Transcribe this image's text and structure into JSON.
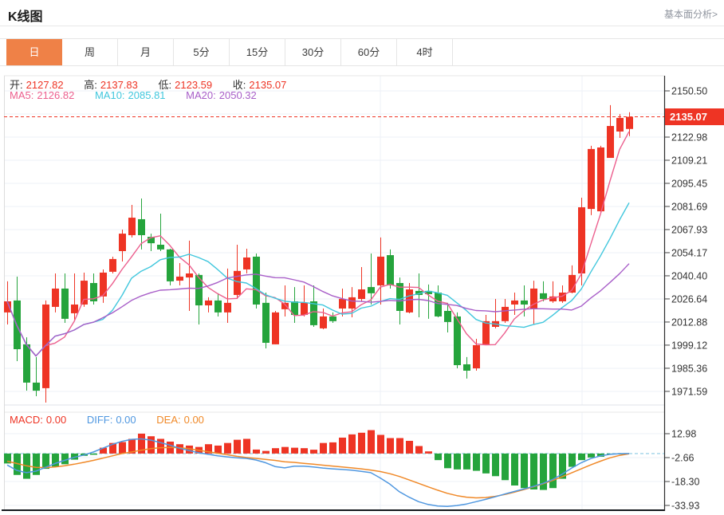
{
  "header": {
    "title": "K线图",
    "link_label": "基本面分析>"
  },
  "tabs": {
    "items": [
      "日",
      "周",
      "月",
      "5分",
      "15分",
      "30分",
      "60分",
      "4时"
    ],
    "active_index": 0
  },
  "info_bar": {
    "open_label": "开:",
    "open_value": "2127.82",
    "high_label": "高:",
    "high_value": "2137.83",
    "low_label": "低:",
    "low_value": "2123.59",
    "close_label": "收:",
    "close_value": "2135.07"
  },
  "ma_bar": {
    "ma5_label": "MA5:",
    "ma5_value": "2126.82",
    "ma10_label": "MA10:",
    "ma10_value": "2085.81",
    "ma20_label": "MA20:",
    "ma20_value": "2050.32"
  },
  "macd_bar": {
    "macd_label": "MACD:",
    "macd_value": "0.00",
    "diff_label": "DIFF:",
    "diff_value": "0.00",
    "dea_label": "DEA:",
    "dea_value": "0.00"
  },
  "colors": {
    "up": "#ee3424",
    "down": "#25a43c",
    "tag": "#ee3424",
    "dashed_price": "#ee3424",
    "ma5": "#ec5f8e",
    "ma10": "#41c7dd",
    "ma20": "#a85ec8",
    "diff_line": "#4f97e0",
    "dea_line": "#f08928",
    "zero_dash": "#9fd4e8",
    "grid": "#edf1f7",
    "axis_text": "#333333",
    "axis_line": "#2b2b2b",
    "value_red": "#ee3424",
    "label_dark": "#333333",
    "active_tab": "#ef8147"
  },
  "chart_data": {
    "type": "candlestick",
    "title": "K线图",
    "legend": [
      "MA5",
      "MA10",
      "MA20",
      "MACD",
      "DIFF",
      "DEA"
    ],
    "price_axis_ticks": [
      "2150.50",
      "2122.98",
      "2109.21",
      "2095.45",
      "2081.69",
      "2067.93",
      "2054.17",
      "2040.40",
      "2026.64",
      "2012.88",
      "1999.12",
      "1985.36",
      "1971.59"
    ],
    "last_price": 2135.07,
    "last_price_label": "2135.07",
    "ylim": [
      1964.7,
      2150.5
    ],
    "ma_periods": [
      5,
      10,
      20
    ],
    "candles": [
      [
        2018.6,
        2037.1,
        2011.4,
        2025.2
      ],
      [
        2025.7,
        2039.9,
        1989.6,
        1996.7
      ],
      [
        1999.6,
        2003.8,
        1972.0,
        1976.8
      ],
      [
        1976.8,
        1992.0,
        1968.7,
        1972.0
      ],
      [
        1973.5,
        2025.7,
        1964.9,
        2023.3
      ],
      [
        2021.9,
        2041.8,
        2018.6,
        2032.8
      ],
      [
        2032.8,
        2041.8,
        2012.4,
        2014.8
      ],
      [
        2018.1,
        2041.8,
        2013.4,
        2023.3
      ],
      [
        2023.3,
        2042.3,
        2021.9,
        2037.5
      ],
      [
        2036.1,
        2041.8,
        2023.3,
        2025.2
      ],
      [
        2028.1,
        2044.2,
        2024.3,
        2042.3
      ],
      [
        2042.8,
        2051.8,
        2041.8,
        2050.4
      ],
      [
        2055.1,
        2067.9,
        2048.9,
        2065.5
      ],
      [
        2064.6,
        2082.6,
        2063.2,
        2075.0
      ],
      [
        2074.1,
        2086.4,
        2056.1,
        2064.6
      ],
      [
        2063.6,
        2065.5,
        2055.1,
        2059.8
      ],
      [
        2058.9,
        2077.4,
        2055.1,
        2056.1
      ],
      [
        2056.1,
        2056.5,
        2034.7,
        2037.1
      ],
      [
        2037.5,
        2048.0,
        2034.7,
        2039.9
      ],
      [
        2039.4,
        2061.3,
        2019.5,
        2041.8
      ],
      [
        2040.9,
        2041.8,
        2011.4,
        2022.8
      ],
      [
        2022.8,
        2027.6,
        2018.6,
        2025.7
      ],
      [
        2025.7,
        2030.0,
        2016.2,
        2018.6
      ],
      [
        2018.6,
        2044.7,
        2012.4,
        2024.3
      ],
      [
        2029.0,
        2058.9,
        2026.6,
        2043.3
      ],
      [
        2044.2,
        2056.5,
        2041.8,
        2051.3
      ],
      [
        2051.8,
        2053.7,
        2020.9,
        2023.3
      ],
      [
        2024.3,
        2030.4,
        1997.2,
        2000.5
      ],
      [
        1999.6,
        2019.5,
        1999.6,
        2018.6
      ],
      [
        2020.5,
        2034.7,
        2016.2,
        2024.3
      ],
      [
        2025.2,
        2033.7,
        2012.4,
        2017.1
      ],
      [
        2017.1,
        2034.7,
        2016.2,
        2024.3
      ],
      [
        2025.2,
        2034.7,
        2010.0,
        2011.0
      ],
      [
        2009.1,
        2020.9,
        2008.6,
        2016.2
      ],
      [
        2016.2,
        2018.6,
        2012.4,
        2013.4
      ],
      [
        2020.9,
        2032.8,
        2016.2,
        2026.6
      ],
      [
        2020.9,
        2033.7,
        2015.7,
        2027.6
      ],
      [
        2026.6,
        2045.6,
        2025.2,
        2032.3
      ],
      [
        2033.7,
        2053.7,
        2023.3,
        2030.0
      ],
      [
        2034.7,
        2063.2,
        2023.3,
        2051.8
      ],
      [
        2052.7,
        2056.1,
        2032.8,
        2034.7
      ],
      [
        2036.1,
        2039.4,
        2011.4,
        2019.5
      ],
      [
        2018.6,
        2036.1,
        2018.1,
        2032.3
      ],
      [
        2031.4,
        2041.8,
        2015.7,
        2029.0
      ],
      [
        2031.4,
        2035.2,
        2014.8,
        2029.5
      ],
      [
        2030.4,
        2034.7,
        2015.7,
        2016.2
      ],
      [
        2019.5,
        2024.3,
        2006.7,
        2012.9
      ],
      [
        2016.2,
        2018.6,
        1985.3,
        1987.2
      ],
      [
        1987.7,
        1992.0,
        1979.2,
        1983.9
      ],
      [
        1985.3,
        2002.9,
        1983.9,
        1999.1
      ],
      [
        1999.6,
        2017.1,
        1999.1,
        2013.4
      ],
      [
        2010.0,
        2026.6,
        2009.1,
        2013.4
      ],
      [
        2013.4,
        2026.6,
        2012.4,
        2021.9
      ],
      [
        2023.3,
        2030.4,
        2017.1,
        2025.7
      ],
      [
        2025.7,
        2034.7,
        2016.2,
        2023.3
      ],
      [
        2020.5,
        2037.5,
        2011.4,
        2032.8
      ],
      [
        2030.0,
        2037.1,
        2025.2,
        2026.6
      ],
      [
        2025.2,
        2037.1,
        2024.3,
        2028.1
      ],
      [
        2025.2,
        2034.7,
        2024.3,
        2030.4
      ],
      [
        2030.4,
        2046.6,
        2030.0,
        2040.9
      ],
      [
        2041.8,
        2086.9,
        2034.7,
        2081.2
      ],
      [
        2080.2,
        2117.8,
        2076.5,
        2115.9
      ],
      [
        2078.8,
        2117.8,
        2077.9,
        2116.8
      ],
      [
        2110.6,
        2142.0,
        2110.6,
        2129.6
      ],
      [
        2126.3,
        2136.7,
        2122.5,
        2134.4
      ],
      [
        2127.82,
        2137.83,
        2123.59,
        2135.07
      ]
    ],
    "macd": {
      "axis_ticks": [
        "12.98",
        "-2.66",
        "-18.30",
        "-33.93"
      ],
      "hist": [
        -6.5,
        -14,
        -16.5,
        -14,
        -10,
        -8.5,
        -7,
        -4,
        -1.5,
        -0.8,
        3.8,
        6.9,
        7.5,
        9.6,
        13,
        11.3,
        9.6,
        7.8,
        6.1,
        5.2,
        4.3,
        6.1,
        5.2,
        6.9,
        9,
        9.6,
        2.6,
        1.7,
        3.5,
        4.3,
        3.8,
        3.5,
        2.5,
        6.9,
        7.3,
        10.4,
        12.5,
        13.6,
        15.3,
        12.2,
        10.1,
        10.1,
        8.3,
        4.9,
        1.4,
        -4.3,
        -9.6,
        -10.4,
        -10.4,
        -11.3,
        -13,
        -14.8,
        -17.4,
        -20.9,
        -22.6,
        -23.5,
        -23.8,
        -22.6,
        -16.5,
        -8.7,
        -4.3,
        -2.6,
        -2.1,
        -0.5,
        -0.2,
        0
      ],
      "diff": [
        -7.5,
        -11,
        -12.5,
        -11.5,
        -9,
        -6.5,
        -4.5,
        -2.5,
        -1,
        1,
        3.5,
        6,
        8,
        9.3,
        9.6,
        8.8,
        7.2,
        5.5,
        3.5,
        2,
        0.5,
        -0.5,
        -1.5,
        -2.2,
        -2.8,
        -3.2,
        -4.2,
        -6,
        -8.5,
        -9.4,
        -8.3,
        -8.3,
        -8.8,
        -9.5,
        -10,
        -10.4,
        -10.9,
        -11.6,
        -12.5,
        -16,
        -20,
        -25,
        -28.5,
        -31.5,
        -33.3,
        -34.3,
        -34.6,
        -34,
        -33,
        -31.5,
        -30,
        -28.3,
        -26.5,
        -24.8,
        -23.2,
        -21.5,
        -19.5,
        -17,
        -13.5,
        -9.5,
        -6,
        -3.3,
        -1.5,
        -0.5,
        -0.1,
        0
      ],
      "dea": [
        -5,
        -6.5,
        -8,
        -9,
        -9.2,
        -8.8,
        -8,
        -7,
        -5.8,
        -4.5,
        -3,
        -1.5,
        0,
        1,
        2.2,
        3.2,
        3.8,
        4,
        3.8,
        3.2,
        2.2,
        1.2,
        0.2,
        -0.8,
        -1.8,
        -2.6,
        -3.2,
        -3.8,
        -4.5,
        -5.4,
        -5.8,
        -6.4,
        -7,
        -7.6,
        -8.2,
        -8.8,
        -9.4,
        -10,
        -10.8,
        -11.8,
        -13.2,
        -15,
        -17.2,
        -19.5,
        -21.8,
        -24,
        -26,
        -27.5,
        -28.5,
        -29,
        -28.8,
        -28,
        -26.8,
        -25.3,
        -23.6,
        -21.8,
        -19.8,
        -17.6,
        -15.2,
        -12.6,
        -10,
        -7.4,
        -5,
        -2.8,
        -1.2,
        -0.2
      ]
    }
  }
}
